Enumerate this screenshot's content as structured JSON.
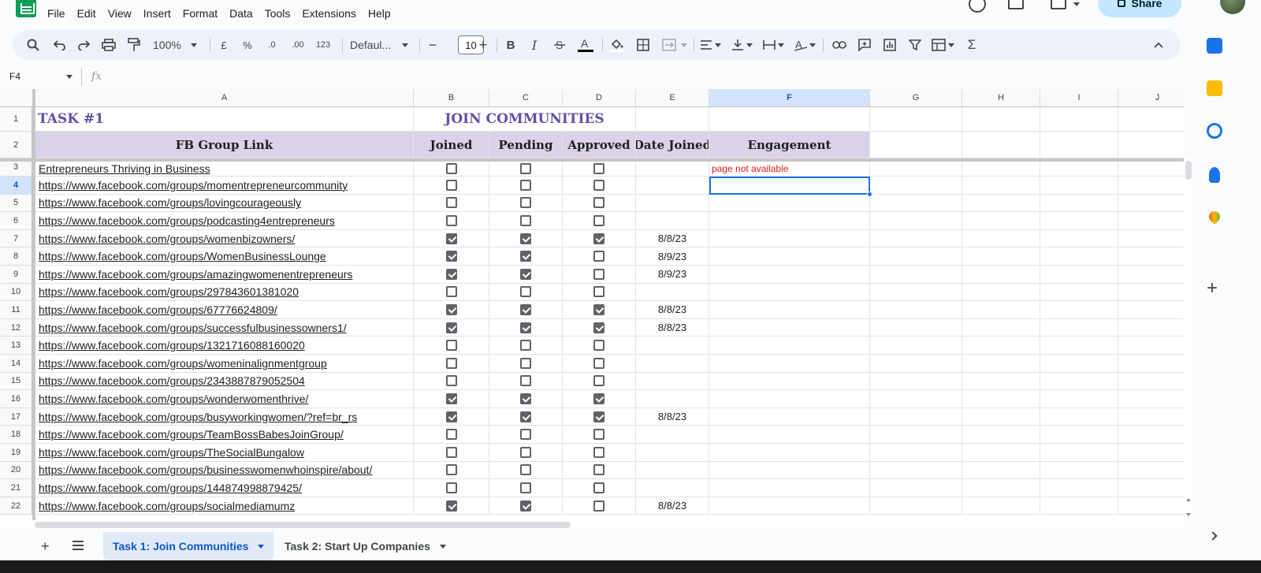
{
  "menu": [
    "File",
    "Edit",
    "View",
    "Insert",
    "Format",
    "Data",
    "Tools",
    "Extensions",
    "Help"
  ],
  "share_label": "Share",
  "toolbar": {
    "zoom": "100%",
    "currency": "£",
    "percent": "%",
    "dec_minus": ".0",
    "dec_plus": ".00",
    "number_format": "123",
    "font": "Defaul...",
    "font_size": "10",
    "bold": "B",
    "italic": "I"
  },
  "formula_bar": {
    "cell_ref": "F4",
    "fx": "fx"
  },
  "columns": [
    "A",
    "B",
    "C",
    "D",
    "E",
    "F",
    "G",
    "H",
    "I",
    "J"
  ],
  "title_row": {
    "a": "TASK #1",
    "bcd": "JOIN COMMUNITIES"
  },
  "header_row": {
    "a": "FB Group Link",
    "b": "Joined",
    "c": "Pending",
    "d": "Approved",
    "e": "Date Joined",
    "f": "Engagement"
  },
  "rows": [
    {
      "n": "3",
      "a": "Entrepreneurs Thriving in Business",
      "b": false,
      "c": false,
      "d": false,
      "e": "",
      "f": "page not available"
    },
    {
      "n": "4",
      "a": "https://www.facebook.com/groups/momentrepreneurcommunity",
      "b": false,
      "c": false,
      "d": false,
      "e": "",
      "f": ""
    },
    {
      "n": "5",
      "a": "https://www.facebook.com/groups/lovingcourageously",
      "b": false,
      "c": false,
      "d": false,
      "e": "",
      "f": ""
    },
    {
      "n": "6",
      "a": "https://www.facebook.com/groups/podcasting4entrepreneurs",
      "b": false,
      "c": false,
      "d": false,
      "e": "",
      "f": ""
    },
    {
      "n": "7",
      "a": "https://www.facebook.com/groups/womenbizowners/",
      "b": true,
      "c": true,
      "d": true,
      "e": "8/8/23",
      "f": ""
    },
    {
      "n": "8",
      "a": "https://www.facebook.com/groups/WomenBusinessLounge",
      "b": true,
      "c": true,
      "d": false,
      "e": "8/9/23",
      "f": ""
    },
    {
      "n": "9",
      "a": "https://www.facebook.com/groups/amazingwomenentrepreneurs",
      "b": true,
      "c": true,
      "d": false,
      "e": "8/9/23",
      "f": ""
    },
    {
      "n": "10",
      "a": "https://www.facebook.com/groups/297843601381020",
      "b": false,
      "c": false,
      "d": false,
      "e": "",
      "f": ""
    },
    {
      "n": "11",
      "a": "https://www.facebook.com/groups/67776624809/",
      "b": true,
      "c": true,
      "d": true,
      "e": "8/8/23",
      "f": ""
    },
    {
      "n": "12",
      "a": "https://www.facebook.com/groups/successfulbusinessowners1/",
      "b": true,
      "c": true,
      "d": true,
      "e": "8/8/23",
      "f": ""
    },
    {
      "n": "13",
      "a": "https://www.facebook.com/groups/1321716088160020",
      "b": false,
      "c": false,
      "d": false,
      "e": "",
      "f": ""
    },
    {
      "n": "14",
      "a": "https://www.facebook.com/groups/womeninalignmentgroup",
      "b": false,
      "c": false,
      "d": false,
      "e": "",
      "f": ""
    },
    {
      "n": "15",
      "a": "https://www.facebook.com/groups/2343887879052504",
      "b": false,
      "c": false,
      "d": false,
      "e": "",
      "f": ""
    },
    {
      "n": "16",
      "a": "https://www.facebook.com/groups/wonderwomenthrive/",
      "b": true,
      "c": true,
      "d": true,
      "e": "",
      "f": ""
    },
    {
      "n": "17",
      "a": "https://www.facebook.com/groups/busyworkingwomen/?ref=br_rs",
      "b": true,
      "c": true,
      "d": true,
      "e": "8/8/23",
      "f": ""
    },
    {
      "n": "18",
      "a": "https://www.facebook.com/groups/TeamBossBabesJoinGroup/",
      "b": false,
      "c": false,
      "d": false,
      "e": "",
      "f": ""
    },
    {
      "n": "19",
      "a": "https://www.facebook.com/groups/TheSocialBungalow",
      "b": false,
      "c": false,
      "d": false,
      "e": "",
      "f": ""
    },
    {
      "n": "20",
      "a": "https://www.facebook.com/groups/businesswomenwhoinspire/about/",
      "b": false,
      "c": false,
      "d": false,
      "e": "",
      "f": ""
    },
    {
      "n": "21",
      "a": "https://www.facebook.com/groups/144874998879425/",
      "b": false,
      "c": false,
      "d": false,
      "e": "",
      "f": ""
    },
    {
      "n": "22",
      "a": "https://www.facebook.com/groups/socialmediamumz",
      "b": true,
      "c": true,
      "d": false,
      "e": "8/8/23",
      "f": ""
    }
  ],
  "row_numbers_top": [
    "1",
    "2"
  ],
  "sheet_tabs": [
    {
      "label": "Task 1: Join Communities",
      "active": true
    },
    {
      "label": "Task 2: Start Up Companies",
      "active": false
    }
  ],
  "colors": {
    "title": "#674ea7",
    "header_fill": "#d9d2e9",
    "selection": "#1a73e8",
    "error_text": "#e01b1b"
  }
}
